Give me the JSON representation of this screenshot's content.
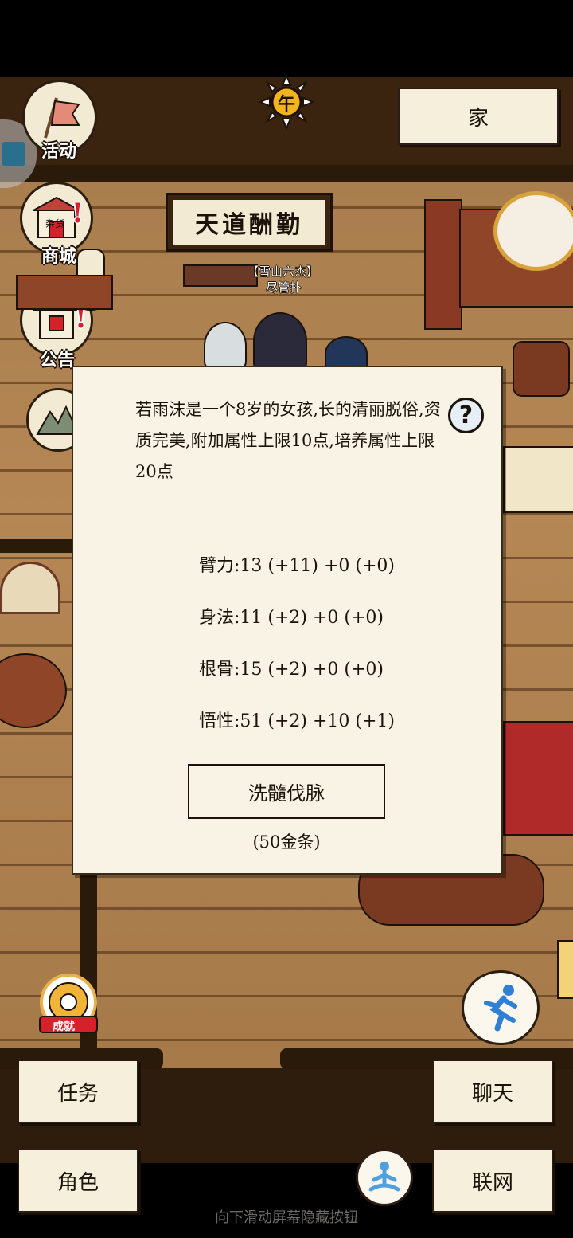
{
  "top": {
    "time_icon_char": "午",
    "home_button_label": "家"
  },
  "sidebar": {
    "activity_label": "活动",
    "shop_label": "商城",
    "shop_sign": "杂货",
    "notice_label": "公告"
  },
  "scene": {
    "plaque_text": "天道酬勤",
    "npc_title": "【雪山六杰】",
    "npc_name": "尽管扑"
  },
  "modal": {
    "description": "若雨沫是一个8岁的女孩,长的清丽脱俗,资质完美,附加属性上限10点,培养属性上限20点",
    "stats": [
      "臂力:13 (+11) +0 (+0)",
      "身法:11 (+2) +0 (+0)",
      "根骨:15 (+2) +0 (+0)",
      "悟性:51 (+2) +10 (+1)"
    ],
    "wash_button_label": "洗髓伐脉",
    "wash_cost": "(50金条)",
    "help_symbol": "?"
  },
  "badges": {
    "achievement_label": "成就"
  },
  "bottom": {
    "task_label": "任务",
    "role_label": "角色",
    "chat_label": "聊天",
    "network_label": "联网",
    "hint_text": "向下滑动屏幕隐藏按钮"
  },
  "colors": {
    "panel_bg": "#f8f3e5",
    "wood": "#a57a4a",
    "accent_red": "#d6202a"
  }
}
